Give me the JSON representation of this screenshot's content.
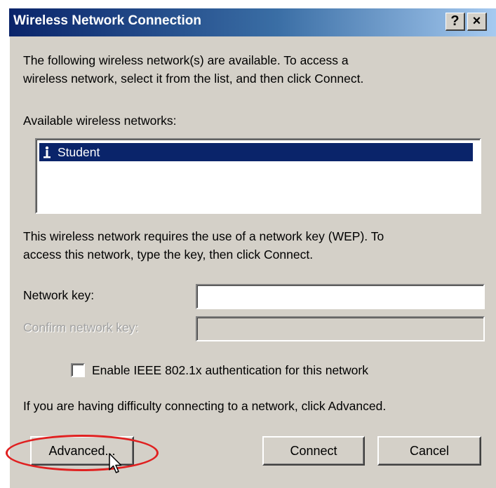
{
  "window": {
    "title": "Wireless Network Connection",
    "help_glyph": "?",
    "close_glyph": "×"
  },
  "intro": {
    "line1": "The following wireless network(s) are available. To access a",
    "line2": "wireless network, select it from the list, and then click Connect."
  },
  "networks": {
    "label": "Available wireless networks:",
    "items": [
      {
        "name": "Student",
        "selected": true,
        "icon": "wireless-antenna-icon"
      }
    ]
  },
  "wep_notice": {
    "line1": "This wireless network requires the use of a network key (WEP). To",
    "line2": "access this network, type the key, then click Connect."
  },
  "form": {
    "network_key_label": "Network key:",
    "network_key_value": "",
    "confirm_key_label": "Confirm network key:",
    "confirm_key_value": "",
    "confirm_disabled": true,
    "ieee_checkbox_label": "Enable IEEE 802.1x authentication for this network",
    "ieee_checked": false
  },
  "advanced_hint": "If you are having difficulty connecting to a network, click Advanced.",
  "buttons": {
    "advanced": "Advanced...",
    "connect": "Connect",
    "cancel": "Cancel"
  },
  "colors": {
    "titlebar_start": "#0a246a",
    "titlebar_end": "#a6caf0",
    "dialog_face": "#d4d0c8",
    "selection": "#0a246a",
    "annotation": "#e02020"
  }
}
